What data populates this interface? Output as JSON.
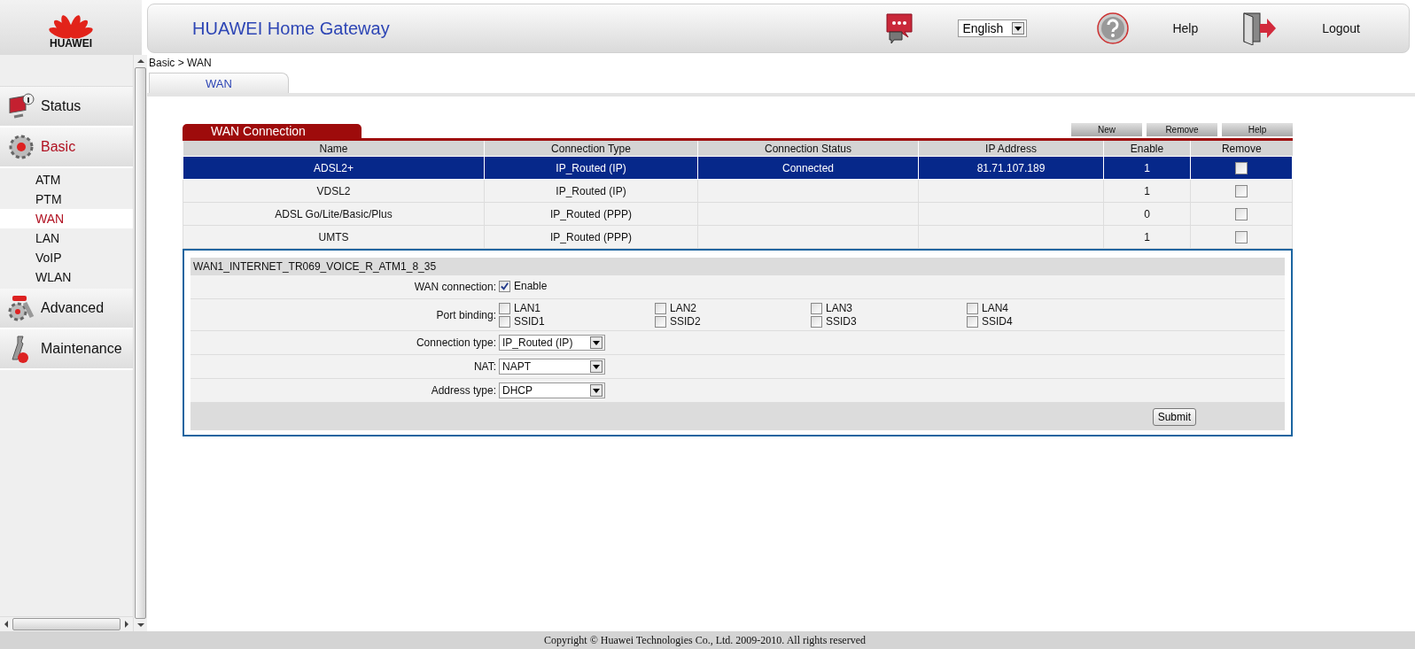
{
  "brand": {
    "name": "HUAWEI"
  },
  "header": {
    "title": "HUAWEI Home Gateway",
    "language": "English",
    "help": "Help",
    "logout": "Logout"
  },
  "breadcrumb": "Basic > WAN",
  "tabs": [
    {
      "label": "WAN",
      "selected": true
    }
  ],
  "sidebar": {
    "items": [
      {
        "label": "Status",
        "selected": false
      },
      {
        "label": "Basic",
        "selected": true,
        "children": [
          {
            "label": "ATM",
            "selected": false
          },
          {
            "label": "PTM",
            "selected": false
          },
          {
            "label": "WAN",
            "selected": true
          },
          {
            "label": "LAN",
            "selected": false
          },
          {
            "label": "VoIP",
            "selected": false
          },
          {
            "label": "WLAN",
            "selected": false
          }
        ]
      },
      {
        "label": "Advanced",
        "selected": false
      },
      {
        "label": "Maintenance",
        "selected": false
      }
    ]
  },
  "wan_connection": {
    "title": "WAN Connection",
    "buttons": [
      "New",
      "Remove",
      "Help"
    ],
    "columns": [
      "Name",
      "Connection Type",
      "Connection Status",
      "IP Address",
      "Enable",
      "Remove"
    ],
    "rows": [
      {
        "name": "ADSL2+",
        "connection_type": "IP_Routed (IP)",
        "connection_status": "Connected",
        "ip_address": "81.71.107.189",
        "enable": "1",
        "remove": false,
        "selected": true
      },
      {
        "name": "VDSL2",
        "connection_type": "IP_Routed (IP)",
        "enable": "1",
        "remove": false,
        "selected": false
      },
      {
        "name": "ADSL Go/Lite/Basic/Plus",
        "connection_type": "IP_Routed (PPP)",
        "enable": "0",
        "remove": false,
        "selected": false
      },
      {
        "name": "UMTS",
        "connection_type": "IP_Routed (PPP)",
        "enable": "1",
        "remove": false,
        "selected": false
      }
    ]
  },
  "detail": {
    "title": "WAN1_INTERNET_TR069_VOICE_R_ATM1_8_35",
    "fields": [
      {
        "kind": "checkbox",
        "label": "WAN connection:",
        "option": "Enable",
        "checked": true
      },
      {
        "kind": "checkbox_grid",
        "label": "Port binding:",
        "options": [
          {
            "label": "LAN1",
            "checked": false
          },
          {
            "label": "LAN2",
            "checked": false
          },
          {
            "label": "LAN3",
            "checked": false
          },
          {
            "label": "LAN4",
            "checked": false
          },
          {
            "label": "SSID1",
            "checked": false
          },
          {
            "label": "SSID2",
            "checked": false
          },
          {
            "label": "SSID3",
            "checked": false
          },
          {
            "label": "SSID4",
            "checked": false
          }
        ]
      },
      {
        "kind": "select",
        "label": "Connection type:",
        "value": "IP_Routed (IP)"
      },
      {
        "kind": "select",
        "label": "NAT:",
        "value": "NAPT"
      },
      {
        "kind": "select",
        "label": "Address type:",
        "value": "DHCP"
      }
    ],
    "submit": "Submit"
  },
  "footer": "Copyright © Huawei Technologies Co., Ltd. 2009-2010. All rights reserved"
}
